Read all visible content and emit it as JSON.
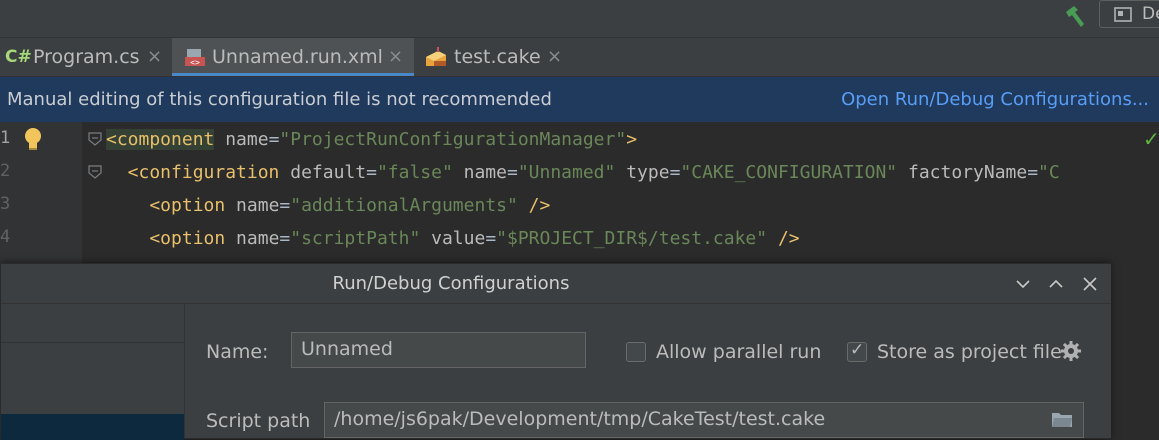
{
  "toolbar": {
    "run_config_label": "De"
  },
  "tabs": [
    {
      "label": "Program.cs",
      "icon": "csharp-file-icon",
      "badge": "C#"
    },
    {
      "label": "Unnamed.run.xml",
      "icon": "xml-run-config-icon"
    },
    {
      "label": "test.cake",
      "icon": "cake-file-icon"
    }
  ],
  "close_glyph": "×",
  "notice": {
    "message": "Manual editing of this configuration file is not recommended",
    "link": "Open Run/Debug Configurations..."
  },
  "editor": {
    "line_numbers": [
      "1",
      "2",
      "3",
      "4"
    ],
    "lines": [
      [
        {
          "t": "<component",
          "c": "tg"
        },
        {
          "t": " name",
          "c": "at"
        },
        {
          "t": "=",
          "c": "pl"
        },
        {
          "t": "\"ProjectRunConfigurationManager\"",
          "c": "vl"
        },
        {
          "t": ">",
          "c": "tg"
        }
      ],
      [
        {
          "t": "  <configuration",
          "c": "tg"
        },
        {
          "t": " default",
          "c": "at"
        },
        {
          "t": "=",
          "c": "pl"
        },
        {
          "t": "\"false\"",
          "c": "vl"
        },
        {
          "t": " name",
          "c": "at"
        },
        {
          "t": "=",
          "c": "pl"
        },
        {
          "t": "\"Unnamed\"",
          "c": "vl"
        },
        {
          "t": " type",
          "c": "at"
        },
        {
          "t": "=",
          "c": "pl"
        },
        {
          "t": "\"CAKE_CONFIGURATION\"",
          "c": "vl"
        },
        {
          "t": " factoryName",
          "c": "at"
        },
        {
          "t": "=",
          "c": "pl"
        },
        {
          "t": "\"C",
          "c": "vl"
        }
      ],
      [
        {
          "t": "    <option",
          "c": "tg"
        },
        {
          "t": " name",
          "c": "at"
        },
        {
          "t": "=",
          "c": "pl"
        },
        {
          "t": "\"additionalArguments\"",
          "c": "vl"
        },
        {
          "t": " />",
          "c": "tg"
        }
      ],
      [
        {
          "t": "    <option",
          "c": "tg"
        },
        {
          "t": " name",
          "c": "at"
        },
        {
          "t": "=",
          "c": "pl"
        },
        {
          "t": "\"scriptPath\"",
          "c": "vl"
        },
        {
          "t": " value",
          "c": "at"
        },
        {
          "t": "=",
          "c": "pl"
        },
        {
          "t": "\"$PROJECT_DIR$/test.cake\"",
          "c": "vl"
        },
        {
          "t": " />",
          "c": "tg"
        }
      ]
    ]
  },
  "dialog": {
    "title": "Run/Debug Configurations",
    "name_label": "Name:",
    "name_value": "Unnamed",
    "allow_parallel_label": "Allow parallel run",
    "allow_parallel_checked": false,
    "store_project_label": "Store as project file",
    "store_project_checked": true,
    "script_path_label": "Script path",
    "script_path_value": "/home/js6pak/Development/tmp/CakeTest/test.cake"
  },
  "colors": {
    "accent": "#4a88c7",
    "notice_bg": "#1f3a5c",
    "link": "#589df6",
    "tag": "#e8bf6a",
    "string": "#6a8759"
  }
}
